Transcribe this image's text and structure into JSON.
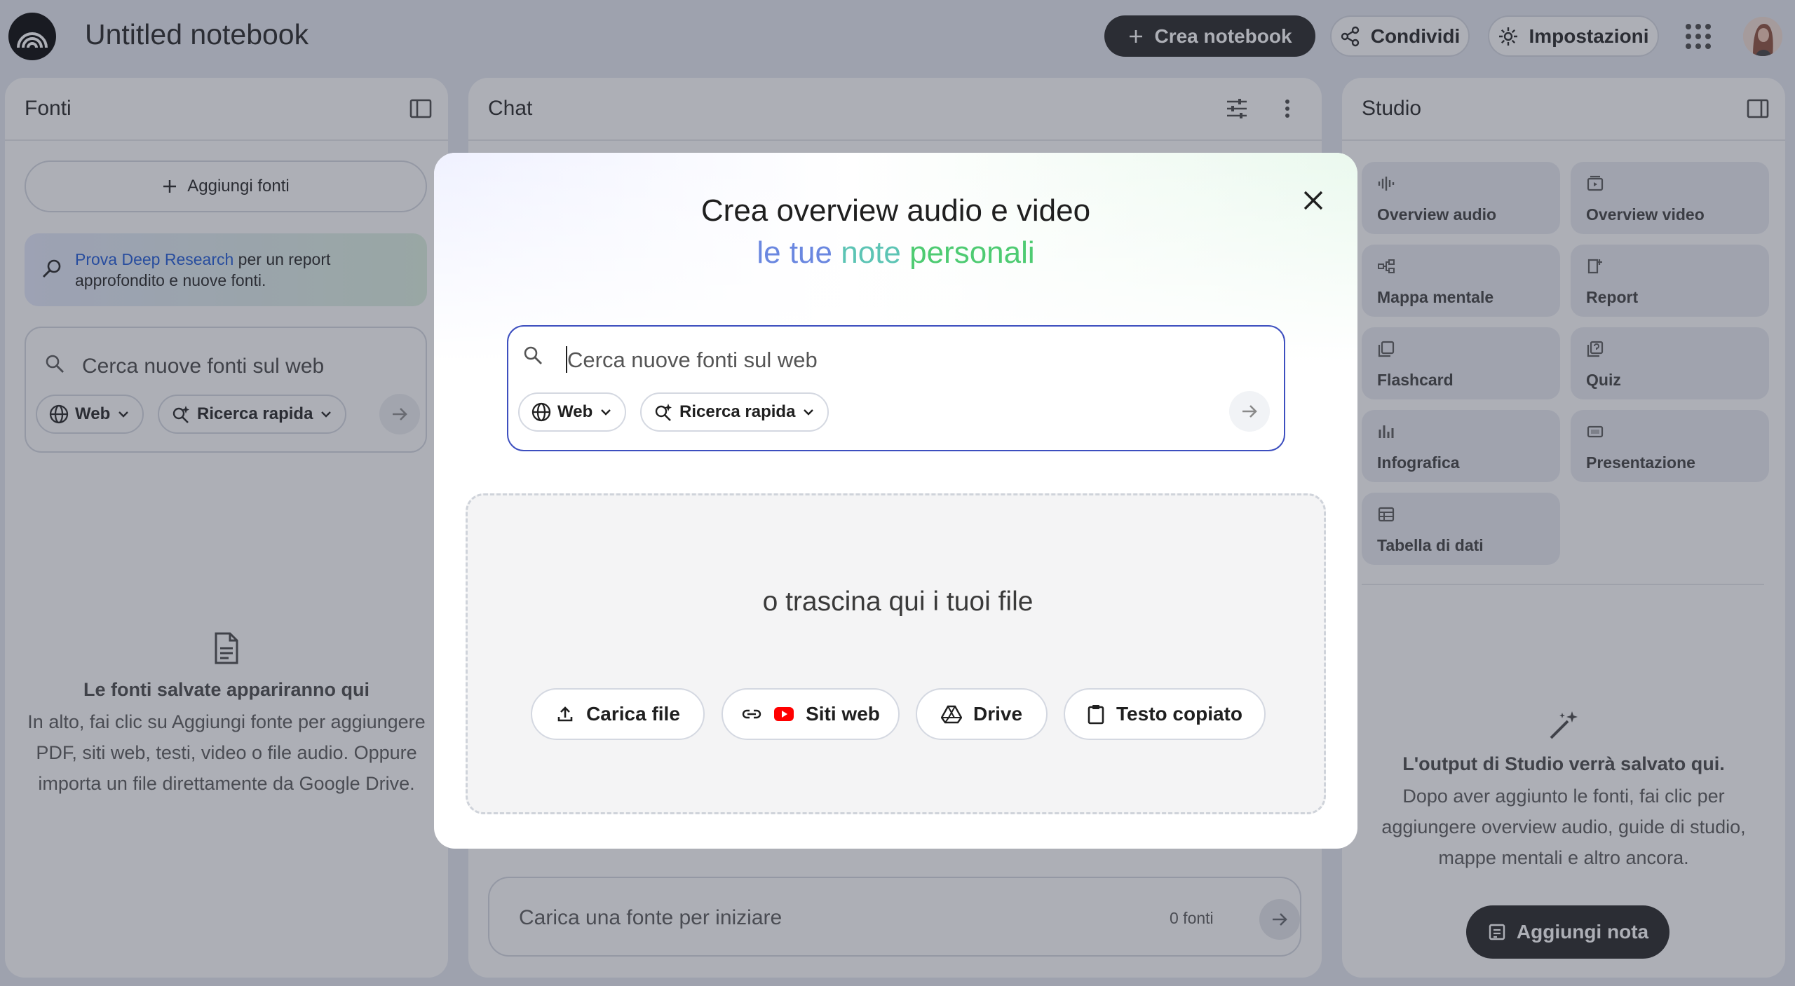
{
  "header": {
    "title": "Untitled notebook",
    "create_label": "Crea notebook",
    "share_label": "Condividi",
    "settings_label": "Impostazioni"
  },
  "sources": {
    "title": "Fonti",
    "add_label": "Aggiungi fonti",
    "deep_link": "Prova Deep Research",
    "deep_rest": " per un report",
    "deep_line2": "approfondito e nuove fonti.",
    "search_placeholder": "Cerca nuove fonti sul web",
    "web_chip": "Web",
    "research_chip": "Ricerca rapida",
    "empty_title": "Le fonti salvate appariranno qui",
    "empty_l1": "In alto, fai clic su Aggiungi fonte per aggiungere",
    "empty_l2": "PDF, siti web, testi, video o file audio. Oppure",
    "empty_l3": "importa un file direttamente da Google Drive."
  },
  "chat": {
    "title": "Chat",
    "input_placeholder": "Carica una fonte per iniziare",
    "source_count": "0 fonti"
  },
  "studio": {
    "title": "Studio",
    "tiles": [
      {
        "label": "Overview audio"
      },
      {
        "label": "Overview video"
      },
      {
        "label": "Mappa mentale"
      },
      {
        "label": "Report"
      },
      {
        "label": "Flashcard"
      },
      {
        "label": "Quiz"
      },
      {
        "label": "Infografica"
      },
      {
        "label": "Presentazione"
      },
      {
        "label": "Tabella di dati"
      }
    ],
    "empty_title": "L'output di Studio verrà salvato qui.",
    "empty_l1": "Dopo aver aggiunto le fonti, fai clic per",
    "empty_l2": "aggiungere overview audio, guide di studio,",
    "empty_l3": "mappe mentali e altro ancora.",
    "add_note_label": "Aggiungi nota"
  },
  "modal": {
    "title": "Crea overview audio e video",
    "sub_a": "le tue",
    "sub_b": "note",
    "sub_c": "personali",
    "search_placeholder": "Cerca nuove fonti sul web",
    "web_chip": "Web",
    "research_chip": "Ricerca rapida",
    "drop_text": "o trascina qui i tuoi file",
    "upload_label": "Carica file",
    "websites_label": "Siti web",
    "drive_label": "Drive",
    "paste_label": "Testo copiato"
  },
  "colors": {
    "accent_dark": "#1f1f1f",
    "link_blue": "#1a56d6",
    "focus_border": "#3d4fbf",
    "youtube_red": "#ff0000"
  }
}
